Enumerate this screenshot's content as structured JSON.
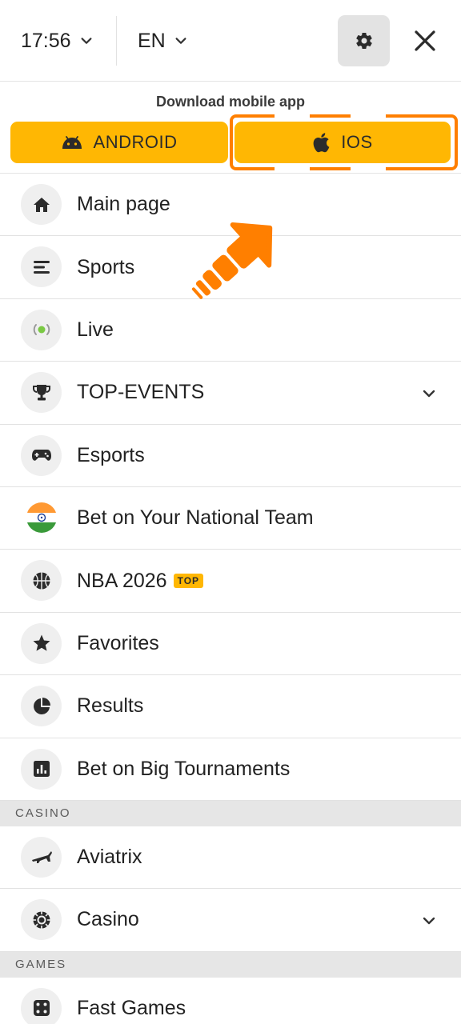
{
  "header": {
    "time": "17:56",
    "language": "EN"
  },
  "download": {
    "title": "Download mobile app",
    "android_label": "ANDROID",
    "ios_label": "IOS"
  },
  "menu": [
    {
      "label": "Main page",
      "icon": "home-icon"
    },
    {
      "label": "Sports",
      "icon": "list-icon"
    },
    {
      "label": "Live",
      "icon": "live-icon"
    },
    {
      "label": "TOP-EVENTS",
      "icon": "trophy-icon",
      "expandable": true
    },
    {
      "label": "Esports",
      "icon": "gamepad-icon"
    },
    {
      "label": "Bet on Your National Team",
      "icon": "india-flag-icon"
    },
    {
      "label": "NBA 2026",
      "icon": "basketball-icon",
      "badge": "TOP"
    },
    {
      "label": "Favorites",
      "icon": "star-icon"
    },
    {
      "label": "Results",
      "icon": "pie-chart-icon"
    },
    {
      "label": "Bet on Big Tournaments",
      "icon": "bar-chart-icon"
    }
  ],
  "casino": {
    "section_title": "CASINO",
    "items": [
      {
        "label": "Aviatrix",
        "icon": "plane-icon"
      },
      {
        "label": "Casino",
        "icon": "chip-icon",
        "expandable": true
      }
    ]
  },
  "games": {
    "section_title": "GAMES",
    "items": [
      {
        "label": "Fast Games",
        "icon": "dice-icon"
      }
    ]
  },
  "colors": {
    "accent": "#ffb703",
    "highlight": "#ff7f00",
    "live_dot": "#7ac943"
  }
}
